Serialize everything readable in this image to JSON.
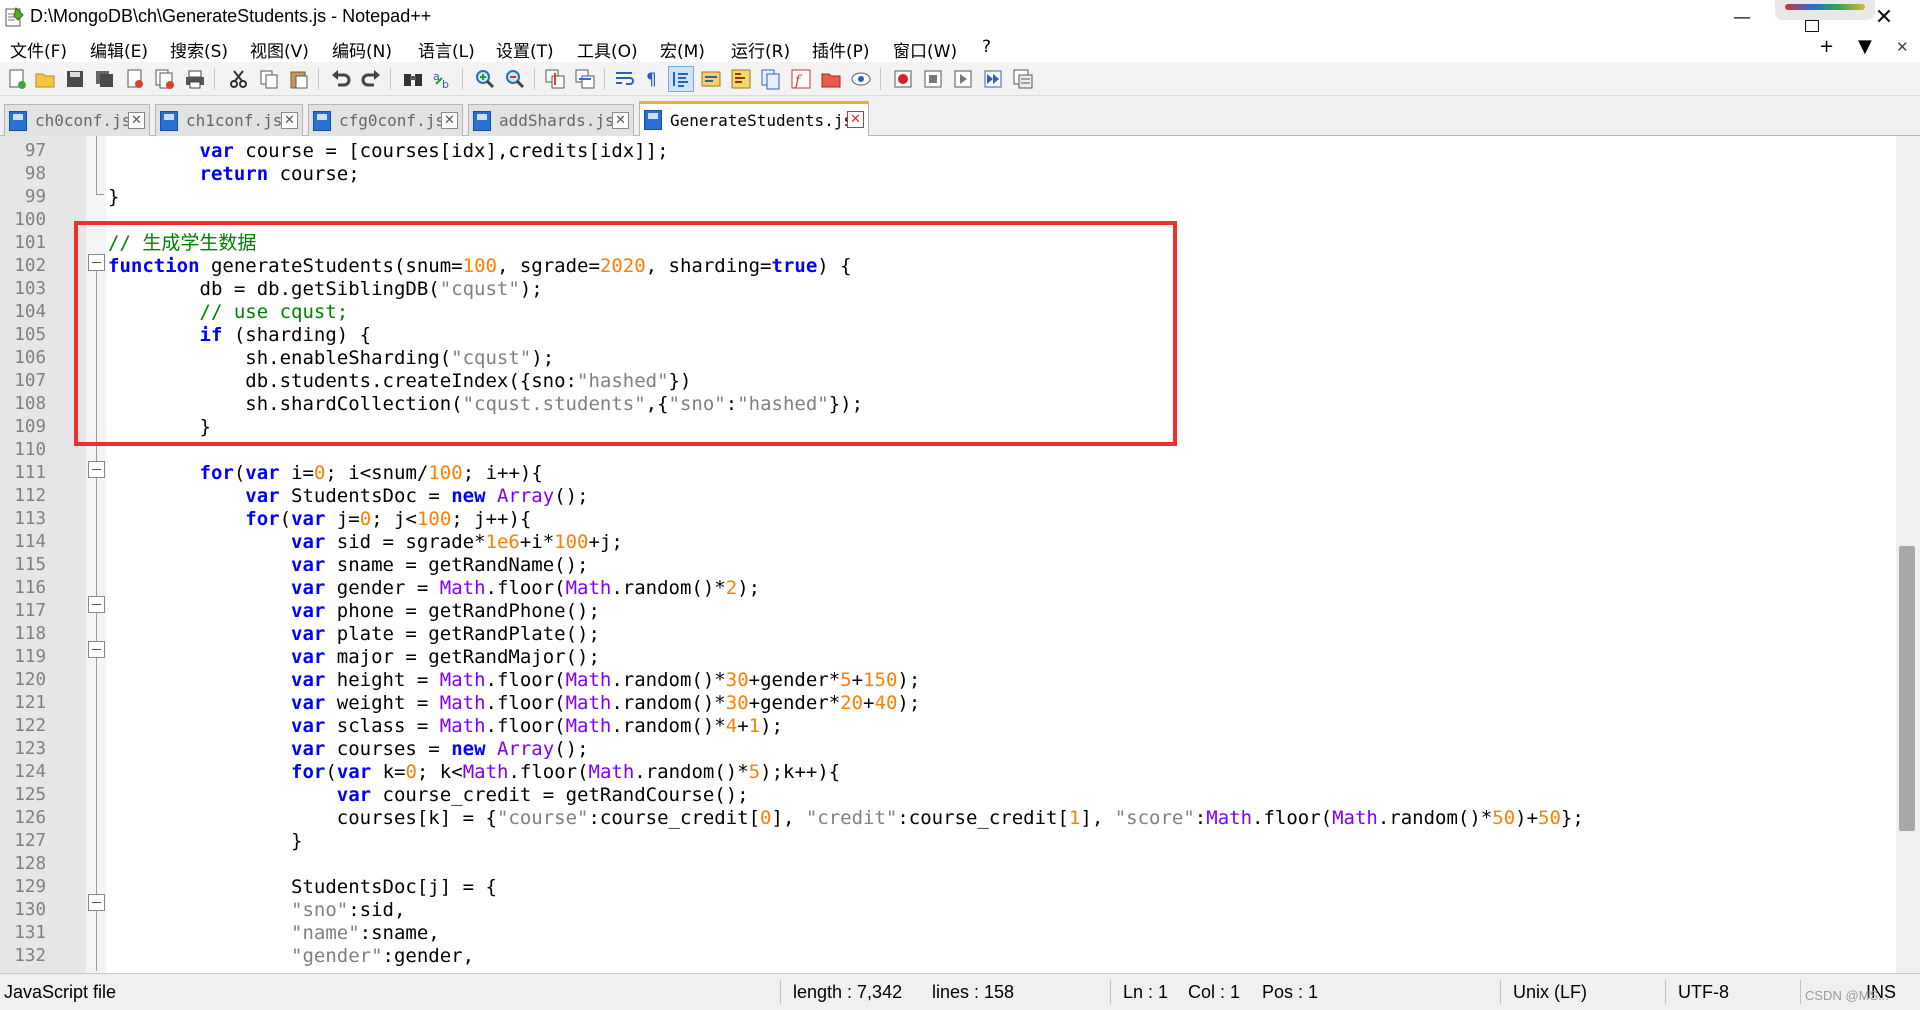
{
  "window": {
    "title": "D:\\MongoDB\\ch\\GenerateStudents.js - Notepad++",
    "minimize": "—",
    "close": "✕"
  },
  "menu": {
    "items": [
      "文件(F)",
      "编辑(E)",
      "搜索(S)",
      "视图(V)",
      "编码(N)",
      "语言(L)",
      "设置(T)",
      "工具(O)",
      "宏(M)",
      "运行(R)",
      "插件(P)",
      "窗口(W)",
      "?"
    ],
    "right": [
      "+",
      "▼",
      "✕"
    ]
  },
  "tabs": [
    {
      "label": "ch0conf.js",
      "active": false
    },
    {
      "label": "ch1conf.js",
      "active": false
    },
    {
      "label": "cfg0conf.js",
      "active": false
    },
    {
      "label": "addShards.js",
      "active": false
    },
    {
      "label": "GenerateStudents.js",
      "active": true
    }
  ],
  "editor": {
    "lines": [
      {
        "no": "97",
        "html": "        <span class='kw'>var</span> course = [courses[idx],credits[idx]];"
      },
      {
        "no": "98",
        "html": "        <span class='kw'>return</span> course;"
      },
      {
        "no": "99",
        "html": "}"
      },
      {
        "no": "100",
        "html": ""
      },
      {
        "no": "101",
        "html": "<span class='cm'>// 生成学生数据</span>"
      },
      {
        "no": "102",
        "html": "<span class='kw'>function</span> generateStudents(snum=<span class='num'>100</span>, sgrade=<span class='num'>2020</span>, sharding=<span class='kw'>true</span>) {"
      },
      {
        "no": "103",
        "html": "        db = db.getSiblingDB(<span class='str'>\"cqust\"</span>);"
      },
      {
        "no": "104",
        "html": "        <span class='cm'>// use cqust;</span>"
      },
      {
        "no": "105",
        "html": "        <span class='kw'>if</span> (sharding) {"
      },
      {
        "no": "106",
        "html": "            sh.enableSharding(<span class='str'>\"cqust\"</span>);"
      },
      {
        "no": "107",
        "html": "            db.students.createIndex({sno:<span class='str'>\"hashed\"</span>})"
      },
      {
        "no": "108",
        "html": "            sh.shardCollection(<span class='str'>\"cqust.students\"</span>,{<span class='str'>\"sno\"</span>:<span class='str'>\"hashed\"</span>});"
      },
      {
        "no": "109",
        "html": "        }"
      },
      {
        "no": "110",
        "html": ""
      },
      {
        "no": "111",
        "html": "        <span class='kw'>for</span>(<span class='kw'>var</span> i=<span class='num'>0</span>; i&lt;snum/<span class='num'>100</span>; i++){"
      },
      {
        "no": "112",
        "html": "            <span class='kw'>var</span> StudentsDoc = <span class='kw'>new</span> <span class='obj'>Array</span>();"
      },
      {
        "no": "113",
        "html": "            <span class='kw'>for</span>(<span class='kw'>var</span> j=<span class='num'>0</span>; j&lt;<span class='num'>100</span>; j++){"
      },
      {
        "no": "114",
        "html": "                <span class='kw'>var</span> sid = sgrade*<span class='num'>1e6</span>+i*<span class='num'>100</span>+j;"
      },
      {
        "no": "115",
        "html": "                <span class='kw'>var</span> sname = getRandName();"
      },
      {
        "no": "116",
        "html": "                <span class='kw'>var</span> gender = <span class='obj'>Math</span>.floor(<span class='obj'>Math</span>.random()*<span class='num'>2</span>);"
      },
      {
        "no": "117",
        "html": "                <span class='kw'>var</span> phone = getRandPhone();"
      },
      {
        "no": "118",
        "html": "                <span class='kw'>var</span> plate = getRandPlate();"
      },
      {
        "no": "119",
        "html": "                <span class='kw'>var</span> major = getRandMajor();"
      },
      {
        "no": "120",
        "html": "                <span class='kw'>var</span> height = <span class='obj'>Math</span>.floor(<span class='obj'>Math</span>.random()*<span class='num'>30</span>+gender*<span class='num'>5</span>+<span class='num'>150</span>);"
      },
      {
        "no": "121",
        "html": "                <span class='kw'>var</span> weight = <span class='obj'>Math</span>.floor(<span class='obj'>Math</span>.random()*<span class='num'>30</span>+gender*<span class='num'>20</span>+<span class='num'>40</span>);"
      },
      {
        "no": "122",
        "html": "                <span class='kw'>var</span> sclass = <span class='obj'>Math</span>.floor(<span class='obj'>Math</span>.random()*<span class='num'>4</span>+<span class='num'>1</span>);"
      },
      {
        "no": "123",
        "html": "                <span class='kw'>var</span> courses = <span class='kw'>new</span> <span class='obj'>Array</span>();"
      },
      {
        "no": "124",
        "html": "                <span class='kw'>for</span>(<span class='kw'>var</span> k=<span class='num'>0</span>; k&lt;<span class='obj'>Math</span>.floor(<span class='obj'>Math</span>.random()*<span class='num'>5</span>);k++){"
      },
      {
        "no": "125",
        "html": "                    <span class='kw'>var</span> course_credit = getRandCourse();"
      },
      {
        "no": "126",
        "html": "                    courses[k] = {<span class='str'>\"course\"</span>:course_credit[<span class='num'>0</span>], <span class='str'>\"credit\"</span>:course_credit[<span class='num'>1</span>], <span class='str'>\"score\"</span>:<span class='obj'>Math</span>.floor(<span class='obj'>Math</span>.random()*<span class='num'>50</span>)+<span class='num'>50</span>};"
      },
      {
        "no": "127",
        "html": "                }"
      },
      {
        "no": "128",
        "html": ""
      },
      {
        "no": "129",
        "html": "                StudentsDoc[j] = {"
      },
      {
        "no": "130",
        "html": "                <span class='str'>\"sno\"</span>:sid,"
      },
      {
        "no": "131",
        "html": "                <span class='str'>\"name\"</span>:sname,"
      },
      {
        "no": "132",
        "html": "                <span class='str'>\"gender\"</span>:gender,"
      }
    ]
  },
  "status": {
    "file_type": "JavaScript file",
    "length": "length : 7,342",
    "lines": "lines : 158",
    "ln": "Ln : 1",
    "col": "Col : 1",
    "pos": "Pos : 1",
    "eol": "Unix (LF)",
    "encoding": "UTF-8",
    "mode": "INS",
    "watermark": "CSDN @MS..."
  }
}
